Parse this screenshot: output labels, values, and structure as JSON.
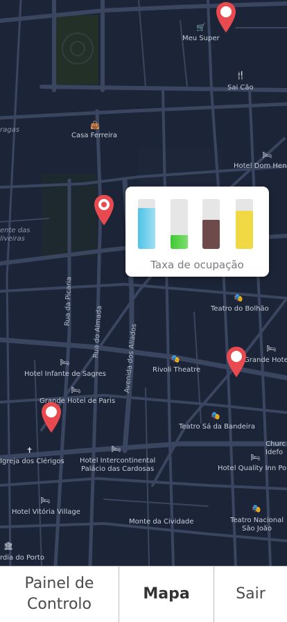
{
  "map": {
    "places": [
      {
        "name": "Meu Super",
        "icon": "cart-icon"
      },
      {
        "name": "Sai Cão",
        "icon": "restaurant-icon"
      },
      {
        "name": "Casa Ferreira",
        "icon": "shop-icon"
      },
      {
        "name": "Hotel Dom Henr",
        "icon": "hotel-icon"
      },
      {
        "name": "Teatro do Bolhão",
        "icon": "theatre-icon"
      },
      {
        "name": "Rivoli Theatre",
        "icon": "theatre-icon"
      },
      {
        "name": "Grande Hotel de",
        "icon": "hotel-icon"
      },
      {
        "name": "Hotel Infante de Sagres",
        "icon": "hotel-icon"
      },
      {
        "name": "Grande Hotel de Paris",
        "icon": "hotel-icon"
      },
      {
        "name": "Teatro Sá da Bandeira",
        "icon": "theatre-icon"
      },
      {
        "name": "Igreja dos Clérigos",
        "icon": "church-icon"
      },
      {
        "name": "Hotel Intercontinental\nPalácio das Cardosas",
        "icon": "hotel-icon"
      },
      {
        "name": "Churc\nIdefo",
        "icon": "church-icon"
      },
      {
        "name": "Hotel Quality Inn Por",
        "icon": "hotel-icon"
      },
      {
        "name": "Hotel Vitória Village",
        "icon": "hotel-icon"
      },
      {
        "name": "Monte da Cividade",
        "icon": "landmark-icon"
      },
      {
        "name": "Teatro Nacional\nSão João",
        "icon": "theatre-icon"
      },
      {
        "name": "rdia do Porto",
        "icon": "landmark-icon"
      },
      {
        "name": "ragas",
        "icon": ""
      },
      {
        "name": "ente das\nliveiras",
        "icon": ""
      }
    ],
    "streets": [
      "Rua da Picaria",
      "Rua do Almada",
      "Avenida dos Aliados"
    ],
    "pin_color": "#e84a4f",
    "map_bg": "#1c2438"
  },
  "occupancy_popup": {
    "title": "Taxa de ocupação",
    "bars": [
      {
        "level": 0.82,
        "color": "#4fc3e8",
        "color_light": "#9fdef2"
      },
      {
        "level": 0.28,
        "color": "#3fc832",
        "color_light": "#7ddf6e"
      },
      {
        "level": 0.58,
        "color": "#6e4a4a",
        "color_light": "#6e4a4a"
      },
      {
        "level": 0.77,
        "color": "#f0d944",
        "color_light": "#f0d944"
      }
    ]
  },
  "navbar": {
    "items": [
      {
        "label": "Painel de\nControlo",
        "active": false
      },
      {
        "label": "Mapa",
        "active": true
      },
      {
        "label": "Sair",
        "active": false
      }
    ]
  }
}
